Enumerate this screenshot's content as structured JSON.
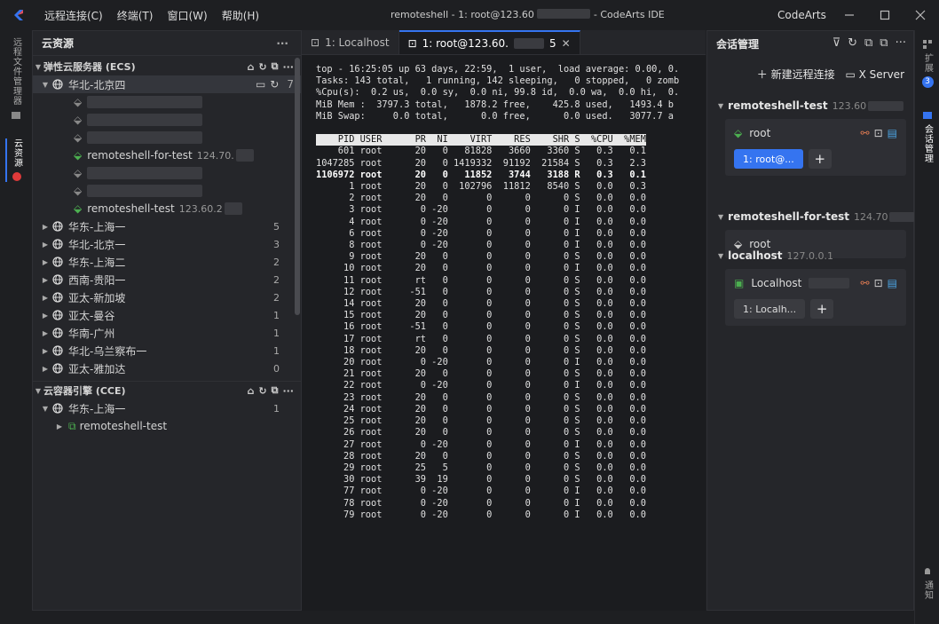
{
  "titlebar": {
    "menus": [
      "远程连接(C)",
      "终端(T)",
      "窗口(W)",
      "帮助(H)"
    ],
    "title_prefix": "remoteshell - 1: root@123.60",
    "title_suffix": "- CodeArts IDE",
    "brand": "CodeArts"
  },
  "activity": {
    "items": [
      "远程文件管理器",
      "云资源"
    ],
    "right_items": [
      "扩展",
      "会话管理",
      "通知"
    ],
    "badge": "3"
  },
  "left_panel": {
    "title": "云资源",
    "ecs_section": "弹性云服务器 (ECS)",
    "region_open": "华北-北京四",
    "region_open_count": "7",
    "hosts": [
      {
        "name": "",
        "active": false
      },
      {
        "name": "",
        "active": false
      },
      {
        "name": "",
        "active": false
      },
      {
        "name": "remoteshell-for-test",
        "ip": "124.70.",
        "active": true
      },
      {
        "name": "",
        "active": false
      },
      {
        "name": "",
        "active": false
      },
      {
        "name": "remoteshell-test",
        "ip": "123.60.2",
        "active": true
      }
    ],
    "regions": [
      {
        "name": "华东-上海一",
        "count": "5"
      },
      {
        "name": "华北-北京一",
        "count": "3"
      },
      {
        "name": "华东-上海二",
        "count": "2"
      },
      {
        "name": "西南-贵阳一",
        "count": "2"
      },
      {
        "name": "亚太-新加坡",
        "count": "2"
      },
      {
        "name": "亚太-曼谷",
        "count": "1"
      },
      {
        "name": "华南-广州",
        "count": "1"
      },
      {
        "name": "华北-乌兰察布一",
        "count": "1"
      },
      {
        "name": "亚太-雅加达",
        "count": "0"
      }
    ],
    "cce_section": "云容器引擎 (CCE)",
    "cce_region": "华东-上海一",
    "cce_region_count": "1",
    "cce_cluster": "remoteshell-test"
  },
  "editor": {
    "tab1": "1: Localhost",
    "tab2": "1: root@123.60.",
    "tab2_suffix": "5",
    "top_lines": [
      "top - 16:25:05 up 63 days, 22:59,  1 user,  load average: 0.00, 0.",
      "Tasks: 143 total,   1 running, 142 sleeping,   0 stopped,   0 zomb",
      "%Cpu(s):  0.2 us,  0.0 sy,  0.0 ni, 99.8 id,  0.0 wa,  0.0 hi,  0.",
      "MiB Mem :  3797.3 total,   1878.2 free,    425.8 used,   1493.4 b",
      "MiB Swap:     0.0 total,      0.0 free,      0.0 used.   3077.7 a"
    ],
    "proc_header": "    PID USER      PR  NI    VIRT    RES    SHR S  %CPU  %MEM",
    "processes": [
      [
        "601",
        "root",
        "20",
        "0",
        "81828",
        "3660",
        "3360",
        "S",
        "0.3",
        "0.1",
        false
      ],
      [
        "1047285",
        "root",
        "20",
        "0",
        "1419332",
        "91192",
        "21584",
        "S",
        "0.3",
        "2.3",
        false
      ],
      [
        "1106972",
        "root",
        "20",
        "0",
        "11852",
        "3744",
        "3188",
        "R",
        "0.3",
        "0.1",
        true
      ],
      [
        "1",
        "root",
        "20",
        "0",
        "102796",
        "11812",
        "8540",
        "S",
        "0.0",
        "0.3",
        false
      ],
      [
        "2",
        "root",
        "20",
        "0",
        "0",
        "0",
        "0",
        "S",
        "0.0",
        "0.0",
        false
      ],
      [
        "3",
        "root",
        "0",
        "-20",
        "0",
        "0",
        "0",
        "I",
        "0.0",
        "0.0",
        false
      ],
      [
        "4",
        "root",
        "0",
        "-20",
        "0",
        "0",
        "0",
        "I",
        "0.0",
        "0.0",
        false
      ],
      [
        "6",
        "root",
        "0",
        "-20",
        "0",
        "0",
        "0",
        "I",
        "0.0",
        "0.0",
        false
      ],
      [
        "8",
        "root",
        "0",
        "-20",
        "0",
        "0",
        "0",
        "I",
        "0.0",
        "0.0",
        false
      ],
      [
        "9",
        "root",
        "20",
        "0",
        "0",
        "0",
        "0",
        "S",
        "0.0",
        "0.0",
        false
      ],
      [
        "10",
        "root",
        "20",
        "0",
        "0",
        "0",
        "0",
        "I",
        "0.0",
        "0.0",
        false
      ],
      [
        "11",
        "root",
        "rt",
        "0",
        "0",
        "0",
        "0",
        "S",
        "0.0",
        "0.0",
        false
      ],
      [
        "12",
        "root",
        "-51",
        "0",
        "0",
        "0",
        "0",
        "S",
        "0.0",
        "0.0",
        false
      ],
      [
        "14",
        "root",
        "20",
        "0",
        "0",
        "0",
        "0",
        "S",
        "0.0",
        "0.0",
        false
      ],
      [
        "15",
        "root",
        "20",
        "0",
        "0",
        "0",
        "0",
        "S",
        "0.0",
        "0.0",
        false
      ],
      [
        "16",
        "root",
        "-51",
        "0",
        "0",
        "0",
        "0",
        "S",
        "0.0",
        "0.0",
        false
      ],
      [
        "17",
        "root",
        "rt",
        "0",
        "0",
        "0",
        "0",
        "S",
        "0.0",
        "0.0",
        false
      ],
      [
        "18",
        "root",
        "20",
        "0",
        "0",
        "0",
        "0",
        "S",
        "0.0",
        "0.0",
        false
      ],
      [
        "20",
        "root",
        "0",
        "-20",
        "0",
        "0",
        "0",
        "I",
        "0.0",
        "0.0",
        false
      ],
      [
        "21",
        "root",
        "20",
        "0",
        "0",
        "0",
        "0",
        "S",
        "0.0",
        "0.0",
        false
      ],
      [
        "22",
        "root",
        "0",
        "-20",
        "0",
        "0",
        "0",
        "I",
        "0.0",
        "0.0",
        false
      ],
      [
        "23",
        "root",
        "20",
        "0",
        "0",
        "0",
        "0",
        "S",
        "0.0",
        "0.0",
        false
      ],
      [
        "24",
        "root",
        "20",
        "0",
        "0",
        "0",
        "0",
        "S",
        "0.0",
        "0.0",
        false
      ],
      [
        "25",
        "root",
        "20",
        "0",
        "0",
        "0",
        "0",
        "S",
        "0.0",
        "0.0",
        false
      ],
      [
        "26",
        "root",
        "20",
        "0",
        "0",
        "0",
        "0",
        "S",
        "0.0",
        "0.0",
        false
      ],
      [
        "27",
        "root",
        "0",
        "-20",
        "0",
        "0",
        "0",
        "I",
        "0.0",
        "0.0",
        false
      ],
      [
        "28",
        "root",
        "20",
        "0",
        "0",
        "0",
        "0",
        "S",
        "0.0",
        "0.0",
        false
      ],
      [
        "29",
        "root",
        "25",
        "5",
        "0",
        "0",
        "0",
        "S",
        "0.0",
        "0.0",
        false
      ],
      [
        "30",
        "root",
        "39",
        "19",
        "0",
        "0",
        "0",
        "S",
        "0.0",
        "0.0",
        false
      ],
      [
        "77",
        "root",
        "0",
        "-20",
        "0",
        "0",
        "0",
        "I",
        "0.0",
        "0.0",
        false
      ],
      [
        "78",
        "root",
        "0",
        "-20",
        "0",
        "0",
        "0",
        "I",
        "0.0",
        "0.0",
        false
      ],
      [
        "79",
        "root",
        "0",
        "-20",
        "0",
        "0",
        "0",
        "I",
        "0.0",
        "0.0",
        false
      ]
    ]
  },
  "right_panel": {
    "title": "会话管理",
    "new_connection": "新建远程连接",
    "xserver": "X Server",
    "groups": [
      {
        "name": "remoteshell-test",
        "ip": "123.60",
        "user": "root",
        "session": "1: root@...",
        "session_active": true,
        "show_icons": true
      },
      {
        "name": "remoteshell-for-test",
        "ip": "124.70",
        "user": "root",
        "session": "",
        "session_active": false,
        "show_icons": false
      },
      {
        "name": "localhost",
        "ip": "127.0.0.1",
        "user": "Localhost",
        "session": "1: Localh...",
        "session_active": false,
        "show_icons": true
      }
    ]
  },
  "colors": {
    "accent": "#3574f0",
    "host_green": "#4caf50",
    "terminal_bg": "#1b1c1f"
  }
}
